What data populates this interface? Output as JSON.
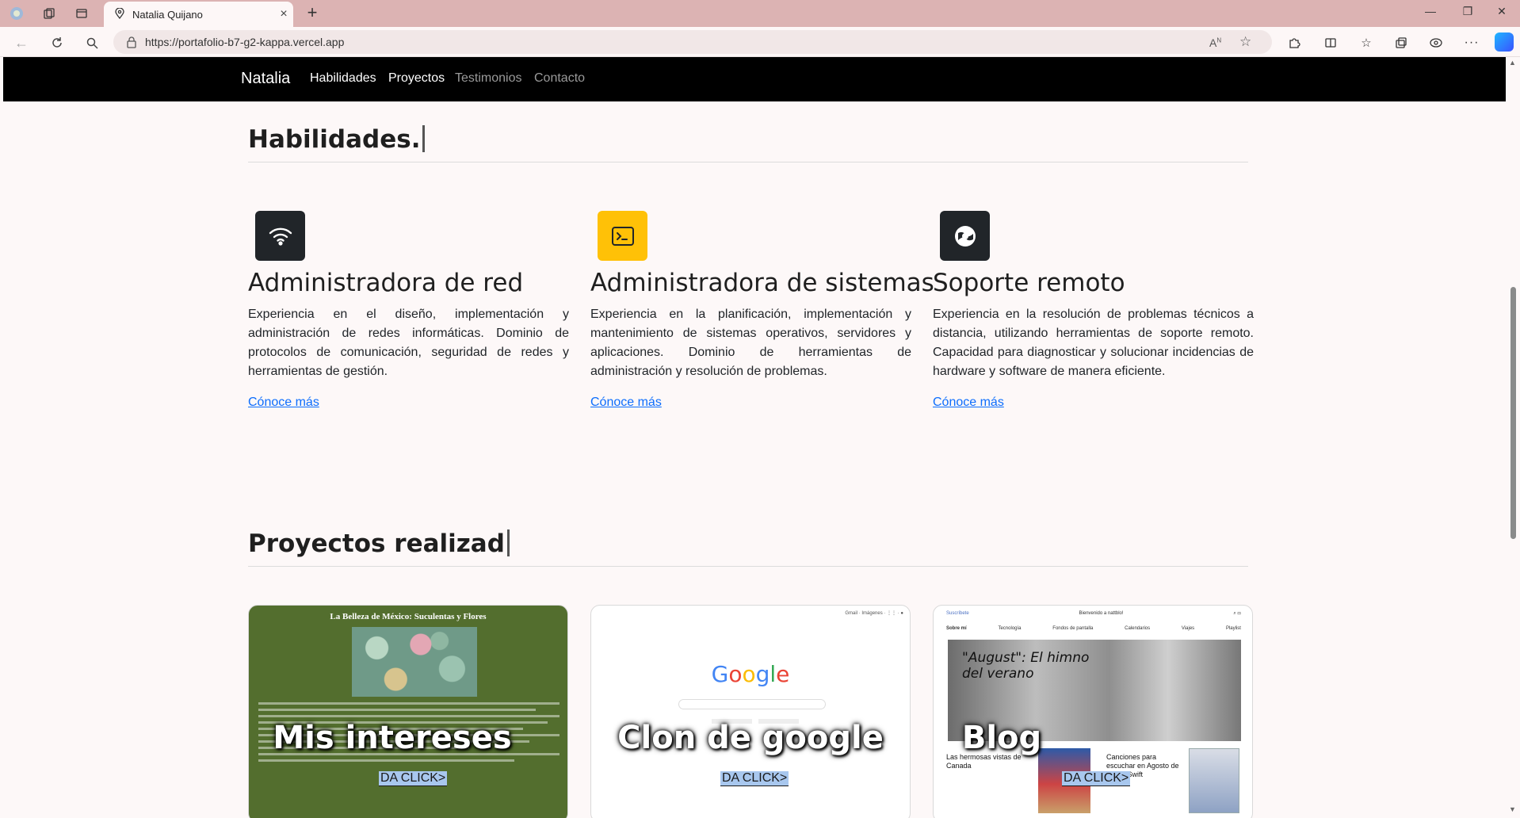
{
  "browser": {
    "tab_title": "Natalia Quijano",
    "url": "https://portafolio-b7-g2-kappa.vercel.app"
  },
  "nav": {
    "brand": "Natalia",
    "links": [
      {
        "label": "Habilidades",
        "color": "#ffffff"
      },
      {
        "label": "Proyectos",
        "color": "#ffffff"
      },
      {
        "label": "Testimonios",
        "color": "#9a9a9a"
      },
      {
        "label": "Contacto",
        "color": "#9a9a9a"
      }
    ]
  },
  "skills_section": {
    "title": "Habilidades.",
    "items": [
      {
        "icon": "wifi-icon",
        "icon_bg": "#212529",
        "title": "Administradora de red",
        "text": "Experiencia en el diseño, implementación y administración de redes informáticas. Dominio de protocolos de comunicación, seguridad de redes y herramientas de gestión.",
        "link": "Cónoce más"
      },
      {
        "icon": "terminal-icon",
        "icon_bg": "#ffc107",
        "title": "Administradora de sistemas",
        "text": "Experiencia en la planificación, implementación y mantenimiento de sistemas operativos, servidores y aplicaciones. Dominio de herramientas de administración y resolución de problemas.",
        "link": "Cónoce más"
      },
      {
        "icon": "globe-remote-icon",
        "icon_bg": "#212529",
        "title": "Soporte remoto",
        "text": "Experiencia en la resolución de problemas técnicos a distancia, utilizando herramientas de soporte remoto. Capacidad para diagnosticar y solucionar incidencias de hardware y software de manera eficiente.",
        "link": "Cónoce más"
      }
    ]
  },
  "projects_section": {
    "title": "Proyectos realizad",
    "cards": [
      {
        "label": "Mis intereses",
        "button": "DA CLICK>",
        "preview_title": "La Belleza de México: Suculentas y Flores"
      },
      {
        "label": "Clon de google",
        "button": "DA CLICK>",
        "preview_title": "Google"
      },
      {
        "label": "Blog",
        "button": "DA CLICK>",
        "preview_title": "\"August\": El himno del verano",
        "preview_items": [
          "Las hermosas vistas de Canada",
          "Canciones para escuchar en Agosto de Taylor Swift"
        ]
      }
    ]
  }
}
